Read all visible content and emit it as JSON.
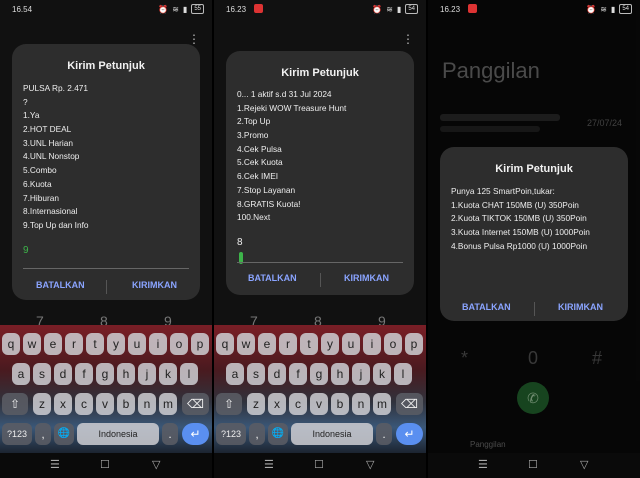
{
  "panels": [
    {
      "status": {
        "time": "16.54",
        "battery": "55"
      },
      "dialog": {
        "title": "Kirim Petunjuk",
        "lines": [
          "PULSA Rp. 2.471",
          "?",
          "1.Ya",
          "2.HOT DEAL",
          "3.UNL Harian",
          "4.UNL Nonstop",
          "5.Combo",
          "6.Kuota",
          "7.Hiburan",
          "8.Internasional",
          "9.Top Up dan Info"
        ],
        "reply_value": "9",
        "cancel": "BATALKAN",
        "send": "KIRIMKAN"
      },
      "bg_keys": [
        "7",
        "8",
        "9"
      ]
    },
    {
      "status": {
        "time": "16.23",
        "battery": "54"
      },
      "dialog": {
        "title": "Kirim Petunjuk",
        "lines": [
          "0... 1 aktif s.d 31 Jul 2024",
          "1.Rejeki WOW Treasure Hunt",
          "2.Top Up",
          "3.Promo",
          "4.Cek Pulsa",
          "5.Cek Kuota",
          "6.Cek IMEI",
          "7.Stop Layanan",
          "8.GRATIS Kuota!",
          "100.Next"
        ],
        "reply_value": "8",
        "cancel": "BATALKAN",
        "send": "KIRIMKAN"
      },
      "bg_keys": [
        "7",
        "8",
        "9"
      ]
    },
    {
      "status": {
        "time": "16.23",
        "battery": "54"
      },
      "screen_title": "Panggilan",
      "call_log": {
        "date": "27/07/24"
      },
      "dialog": {
        "title": "Kirim Petunjuk",
        "lines": [
          "Punya 125 SmartPoin,tukar:",
          "1.Kuota CHAT 150MB (U) 350Poin",
          "2.Kuota TIKTOK 150MB (U) 350Poin",
          "3.Kuota Internet 150MB (U) 1000Poin",
          "4.Bonus Pulsa Rp1000 (U) 1000Poin"
        ],
        "cancel": "BATALKAN",
        "send": "KIRIMKAN"
      },
      "keypad": [
        "*",
        "0",
        "#"
      ],
      "footer_tab": "Panggilan"
    }
  ],
  "keyboard": {
    "row1": [
      "q",
      "w",
      "e",
      "r",
      "t",
      "y",
      "u",
      "i",
      "o",
      "p"
    ],
    "row2": [
      "a",
      "s",
      "d",
      "f",
      "g",
      "h",
      "j",
      "k",
      "l"
    ],
    "row3": [
      "z",
      "x",
      "c",
      "v",
      "b",
      "n",
      "m"
    ],
    "sym": "?123",
    "comma": ",",
    "space": "Indonesia",
    "period": ".",
    "enter_icon": "↵",
    "shift_icon": "⇧",
    "backspace_icon": "⌫",
    "globe_icon": "🌐"
  },
  "nav": {
    "recents": "☰",
    "home": "☐",
    "back": "▽"
  },
  "colors": {
    "accent": "#8aa4ff",
    "dialog_bg": "#2d2d2d",
    "cursor": "#3db44a",
    "enter": "#5a8ff0"
  }
}
